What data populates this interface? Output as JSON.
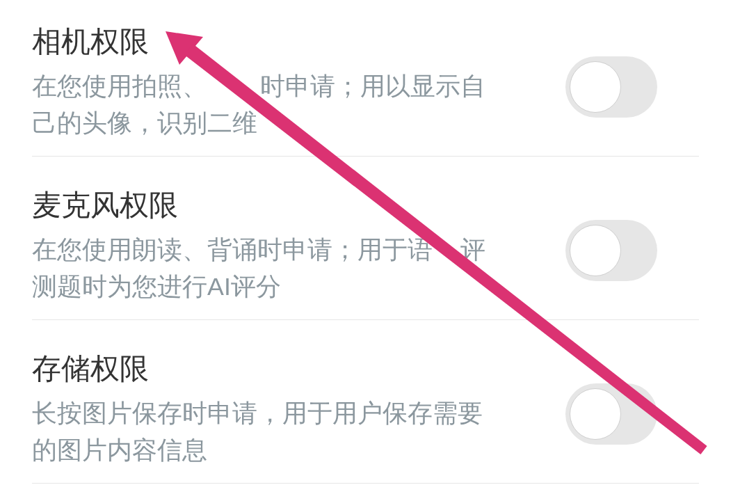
{
  "permissions": [
    {
      "title": "相机权限",
      "description_lines": [
        [
          "在您使用拍照、",
          "时申请；用以显示自"
        ],
        [
          "己的头像，识别二维"
        ]
      ],
      "on": false
    },
    {
      "title": "麦克风权限",
      "description_lines": [
        [
          "在您使用朗读、背诵时申请；用于语",
          "评"
        ],
        [
          "测题时为您进行AI评分"
        ]
      ],
      "on": false
    },
    {
      "title": "存储权限",
      "description": "长按图片保存时申请，用于用户保存需要的图片内容信息",
      "on": false
    }
  ]
}
